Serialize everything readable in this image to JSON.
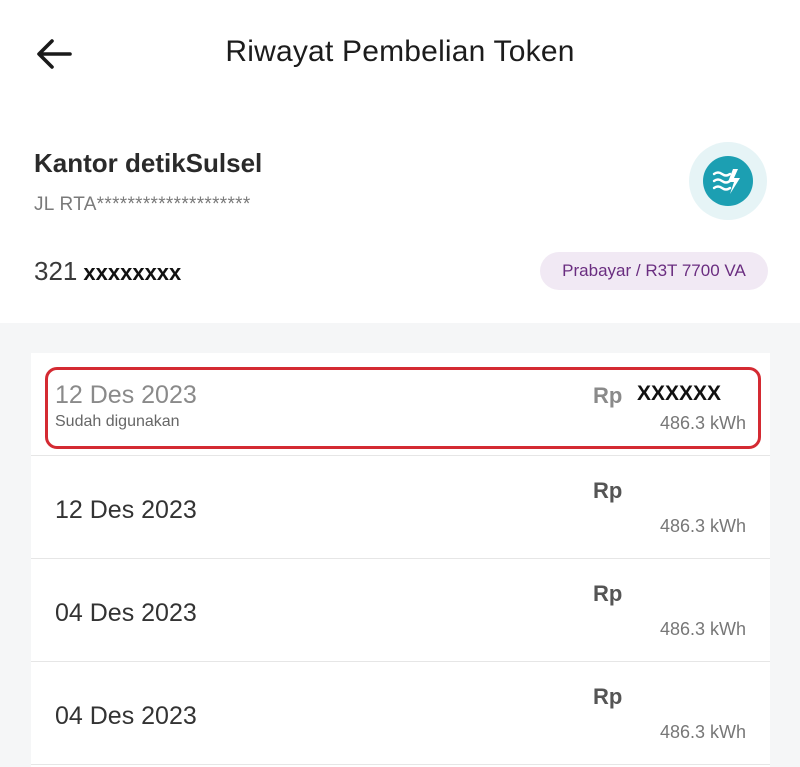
{
  "header": {
    "title": "Riwayat Pembelian Token",
    "back_icon": "arrow-left-icon"
  },
  "customer": {
    "name": "Kantor detikSulsel",
    "address": "JL RTA********************",
    "meter_prefix": "321",
    "meter_masked": "xxxxxxxx",
    "badge": "Prabayar / R3T 7700 VA",
    "logo_icon": "pln-logo-icon",
    "colors": {
      "logo": "#1c9fb2",
      "badge_bg": "#f1e9f4",
      "badge_text": "#6a2d80",
      "highlight": "#d42a32"
    }
  },
  "purchases": [
    {
      "date": "12 Des 2023",
      "status": "Sudah digunakan",
      "currency": "Rp",
      "amount": "XXXXXX",
      "kwh": "486.3 kWh"
    },
    {
      "date": "12 Des 2023",
      "status": "",
      "currency": "Rp",
      "amount": "",
      "kwh": "486.3 kWh"
    },
    {
      "date": "04 Des 2023",
      "status": "",
      "currency": "Rp",
      "amount": "",
      "kwh": "486.3 kWh"
    },
    {
      "date": "04 Des 2023",
      "status": "",
      "currency": "Rp",
      "amount": "",
      "kwh": "486.3 kWh"
    }
  ]
}
